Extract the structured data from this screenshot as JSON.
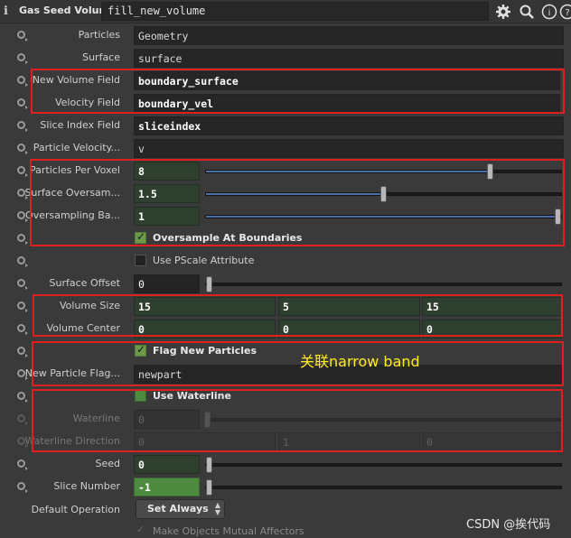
{
  "header": {
    "node_type": "Gas Seed Volume",
    "node_name": "fill_new_volume"
  },
  "params": {
    "particles": {
      "label": "Particles",
      "value": "Geometry"
    },
    "surface": {
      "label": "Surface",
      "value": "surface"
    },
    "new_volume_field": {
      "label": "New Volume Field",
      "value": "boundary_surface"
    },
    "velocity_field": {
      "label": "Velocity Field",
      "value": "boundary_vel"
    },
    "slice_index_field": {
      "label": "Slice Index Field",
      "value": "sliceindex"
    },
    "particle_velocity": {
      "label": "Particle Velocity...",
      "value": "v"
    },
    "particles_per_voxel": {
      "label": "Particles Per Voxel",
      "value": "8",
      "fraction": 0.8
    },
    "surface_oversampling": {
      "label": "Surface Oversam...",
      "value": "1.5",
      "fraction": 0.5
    },
    "oversampling_bandwidth": {
      "label": "Oversampling Ba...",
      "value": "1",
      "fraction": 1.0
    },
    "oversample_at_boundaries": {
      "label": "Oversample At Boundaries",
      "checked": true
    },
    "use_pscale": {
      "label": "Use PScale Attribute",
      "checked": false
    },
    "surface_offset": {
      "label": "Surface Offset",
      "value": "0",
      "fraction": 0.0
    },
    "volume_size": {
      "label": "Volume Size",
      "x": "15",
      "y": "5",
      "z": "15"
    },
    "volume_center": {
      "label": "Volume Center",
      "x": "0",
      "y": "0",
      "z": "0"
    },
    "flag_new_particles": {
      "label": "Flag New Particles",
      "checked": true
    },
    "new_particle_flag": {
      "label": "New Particle Flag...",
      "value": "newpart"
    },
    "use_waterline": {
      "label": "Use Waterline",
      "checked": false
    },
    "waterline": {
      "label": "Waterline",
      "value": "0"
    },
    "waterline_direction": {
      "label": "Waterline Direction",
      "x": "0",
      "y": "1",
      "z": "0"
    },
    "seed": {
      "label": "Seed",
      "value": "0",
      "fraction": 0.0
    },
    "slice_number": {
      "label": "Slice Number",
      "value": "-1",
      "fraction": 0.0
    },
    "default_operation": {
      "label": "Default Operation",
      "value": "Set Always"
    },
    "make_objects_mutual": {
      "label": "Make Objects Mutual Affectors",
      "checked": true
    }
  },
  "annotation": "关联narrow band",
  "watermark": "CSDN @挨代码",
  "colors": {
    "highlight_box": "#e02020",
    "annotation_text": "#ffeb1f",
    "slider_fill": "#4a6fa8",
    "number_field_bg": "#2f3f2f"
  },
  "icons": [
    "info-icon",
    "gear-icon",
    "search-icon",
    "help-icon",
    "question-icon"
  ]
}
